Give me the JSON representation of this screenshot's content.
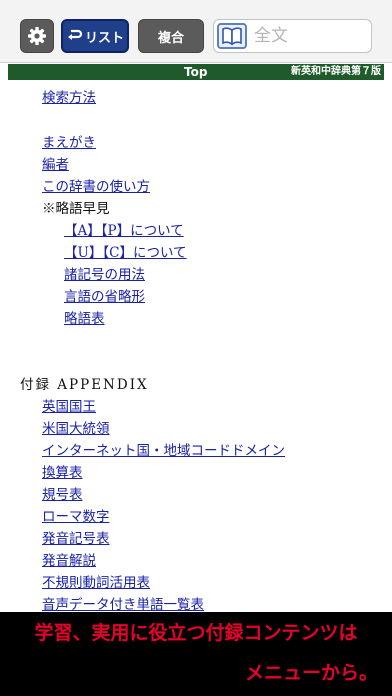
{
  "toolbar": {
    "list_label": "リスト",
    "fukugo_label": "複合",
    "search_placeholder": "全文"
  },
  "titlebar": {
    "title": "Top",
    "dictionary": "新英和中辞典第７版"
  },
  "menu": {
    "kensaku": "検索方法",
    "maegaki": "まえがき",
    "hensha": "編者",
    "tsukaikata": "この辞書の使い方",
    "ryakugo_header": "※略語早見",
    "ap": "【A】【P】について",
    "uc": "【U】【C】について",
    "shokigo": "諸記号の用法",
    "gengo": "言語の省略形",
    "ryakugohyo": "略語表"
  },
  "appendix": {
    "title": "付録 APPENDIX",
    "items": [
      "英国国王",
      "米国大統領",
      "インターネット国・地域コードドメイン",
      "換算表",
      "規号表",
      "ローマ数字",
      "発音記号表",
      "発音解説",
      "不規則動詞活用表",
      "音声データ付き単語一覧表"
    ]
  },
  "banner": {
    "line1": "学習、実用に役立つ付録コンテンツは",
    "line2": "メニューから。"
  },
  "colors": {
    "link": "#1a22a8",
    "titlebar": "#1f5a2a",
    "list_button": "#1f3f8a",
    "banner_text": "#e8002c"
  }
}
